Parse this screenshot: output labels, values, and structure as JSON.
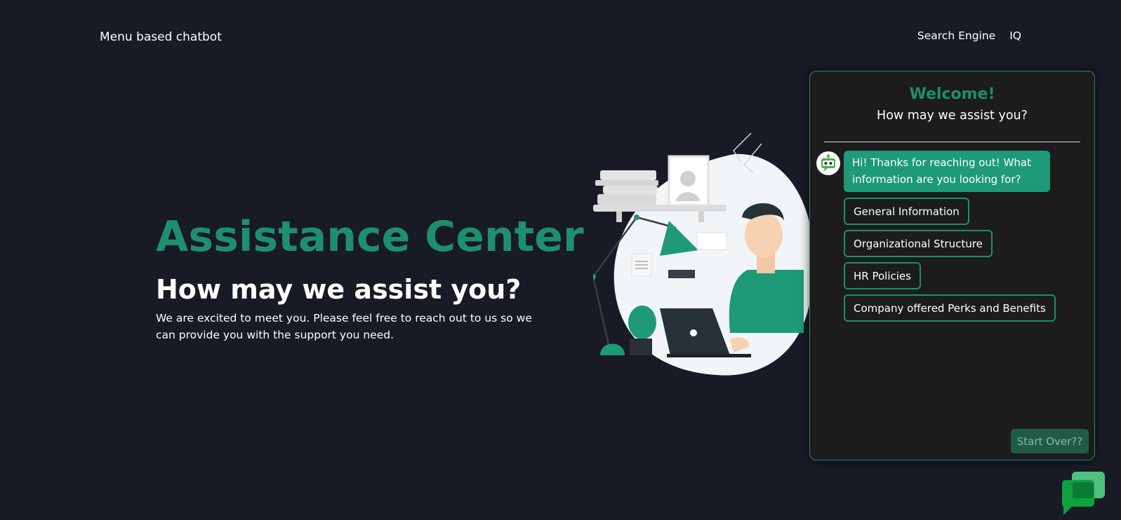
{
  "header": {
    "brand": "Menu based chatbot",
    "nav": [
      {
        "label": "Search Engine"
      },
      {
        "label": "IQ"
      }
    ]
  },
  "hero": {
    "title": "Assistance Center",
    "subtitle": "How may we assist you?",
    "description": "We are excited to meet you. Please feel free to reach out to us so we can provide you with the support you need."
  },
  "chat": {
    "title": "Welcome!",
    "subtitle": "How may we assist you?",
    "bot_message": "Hi! Thanks for reaching out! What information are you looking for?",
    "options": [
      {
        "label": "General Information"
      },
      {
        "label": "Organizational Structure"
      },
      {
        "label": "HR Policies"
      },
      {
        "label": "Company offered Perks and Benefits"
      }
    ],
    "start_over": "Start Over??"
  },
  "icons": {
    "bot_avatar": "robot-icon",
    "chat_fab": "chat-bubbles-icon",
    "illustration": "person-at-laptop-illustration"
  },
  "colors": {
    "background": "#181a25",
    "accent": "#1e8f6c",
    "bubble": "#1e9a76",
    "panel": "#1c1c1c"
  }
}
